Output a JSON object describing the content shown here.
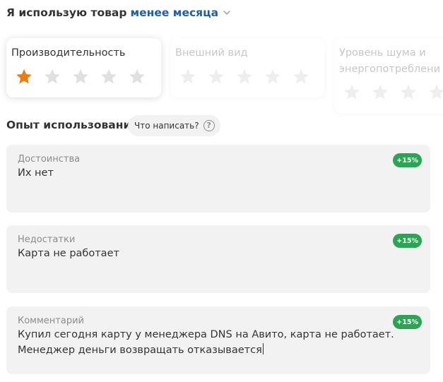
{
  "usage": {
    "prefix": "Я использую товар",
    "period": "менее месяца"
  },
  "ratings": [
    {
      "title": "Производительность",
      "value": 1,
      "max": 5
    },
    {
      "title": "Внешний вид",
      "value": 0,
      "max": 5
    },
    {
      "title_line1": "Уровень шума и",
      "title_line2": "энергопотреблени",
      "value": 0,
      "max": 5
    }
  ],
  "experience": {
    "title": "Опыт использования",
    "help_label": "Что написать?",
    "help_icon": "?"
  },
  "fields": [
    {
      "label": "Достоинства",
      "value": "Их нет",
      "badge": "+15%"
    },
    {
      "label": "Недостатки",
      "value": "Карта не работает",
      "badge": "+15%"
    },
    {
      "label": "Комментарий",
      "value": "Купил сегодня карту у менеджера DNS на Авито, карта не работает. Менеджер деньги возвращать отказывается",
      "badge": "+15%"
    }
  ],
  "colors": {
    "star_active": "#f07b0c",
    "star_inactive": "#e0e0e0",
    "star_disabled": "#eeeeee",
    "link": "#1f5f9e",
    "badge": "#2aa553"
  }
}
